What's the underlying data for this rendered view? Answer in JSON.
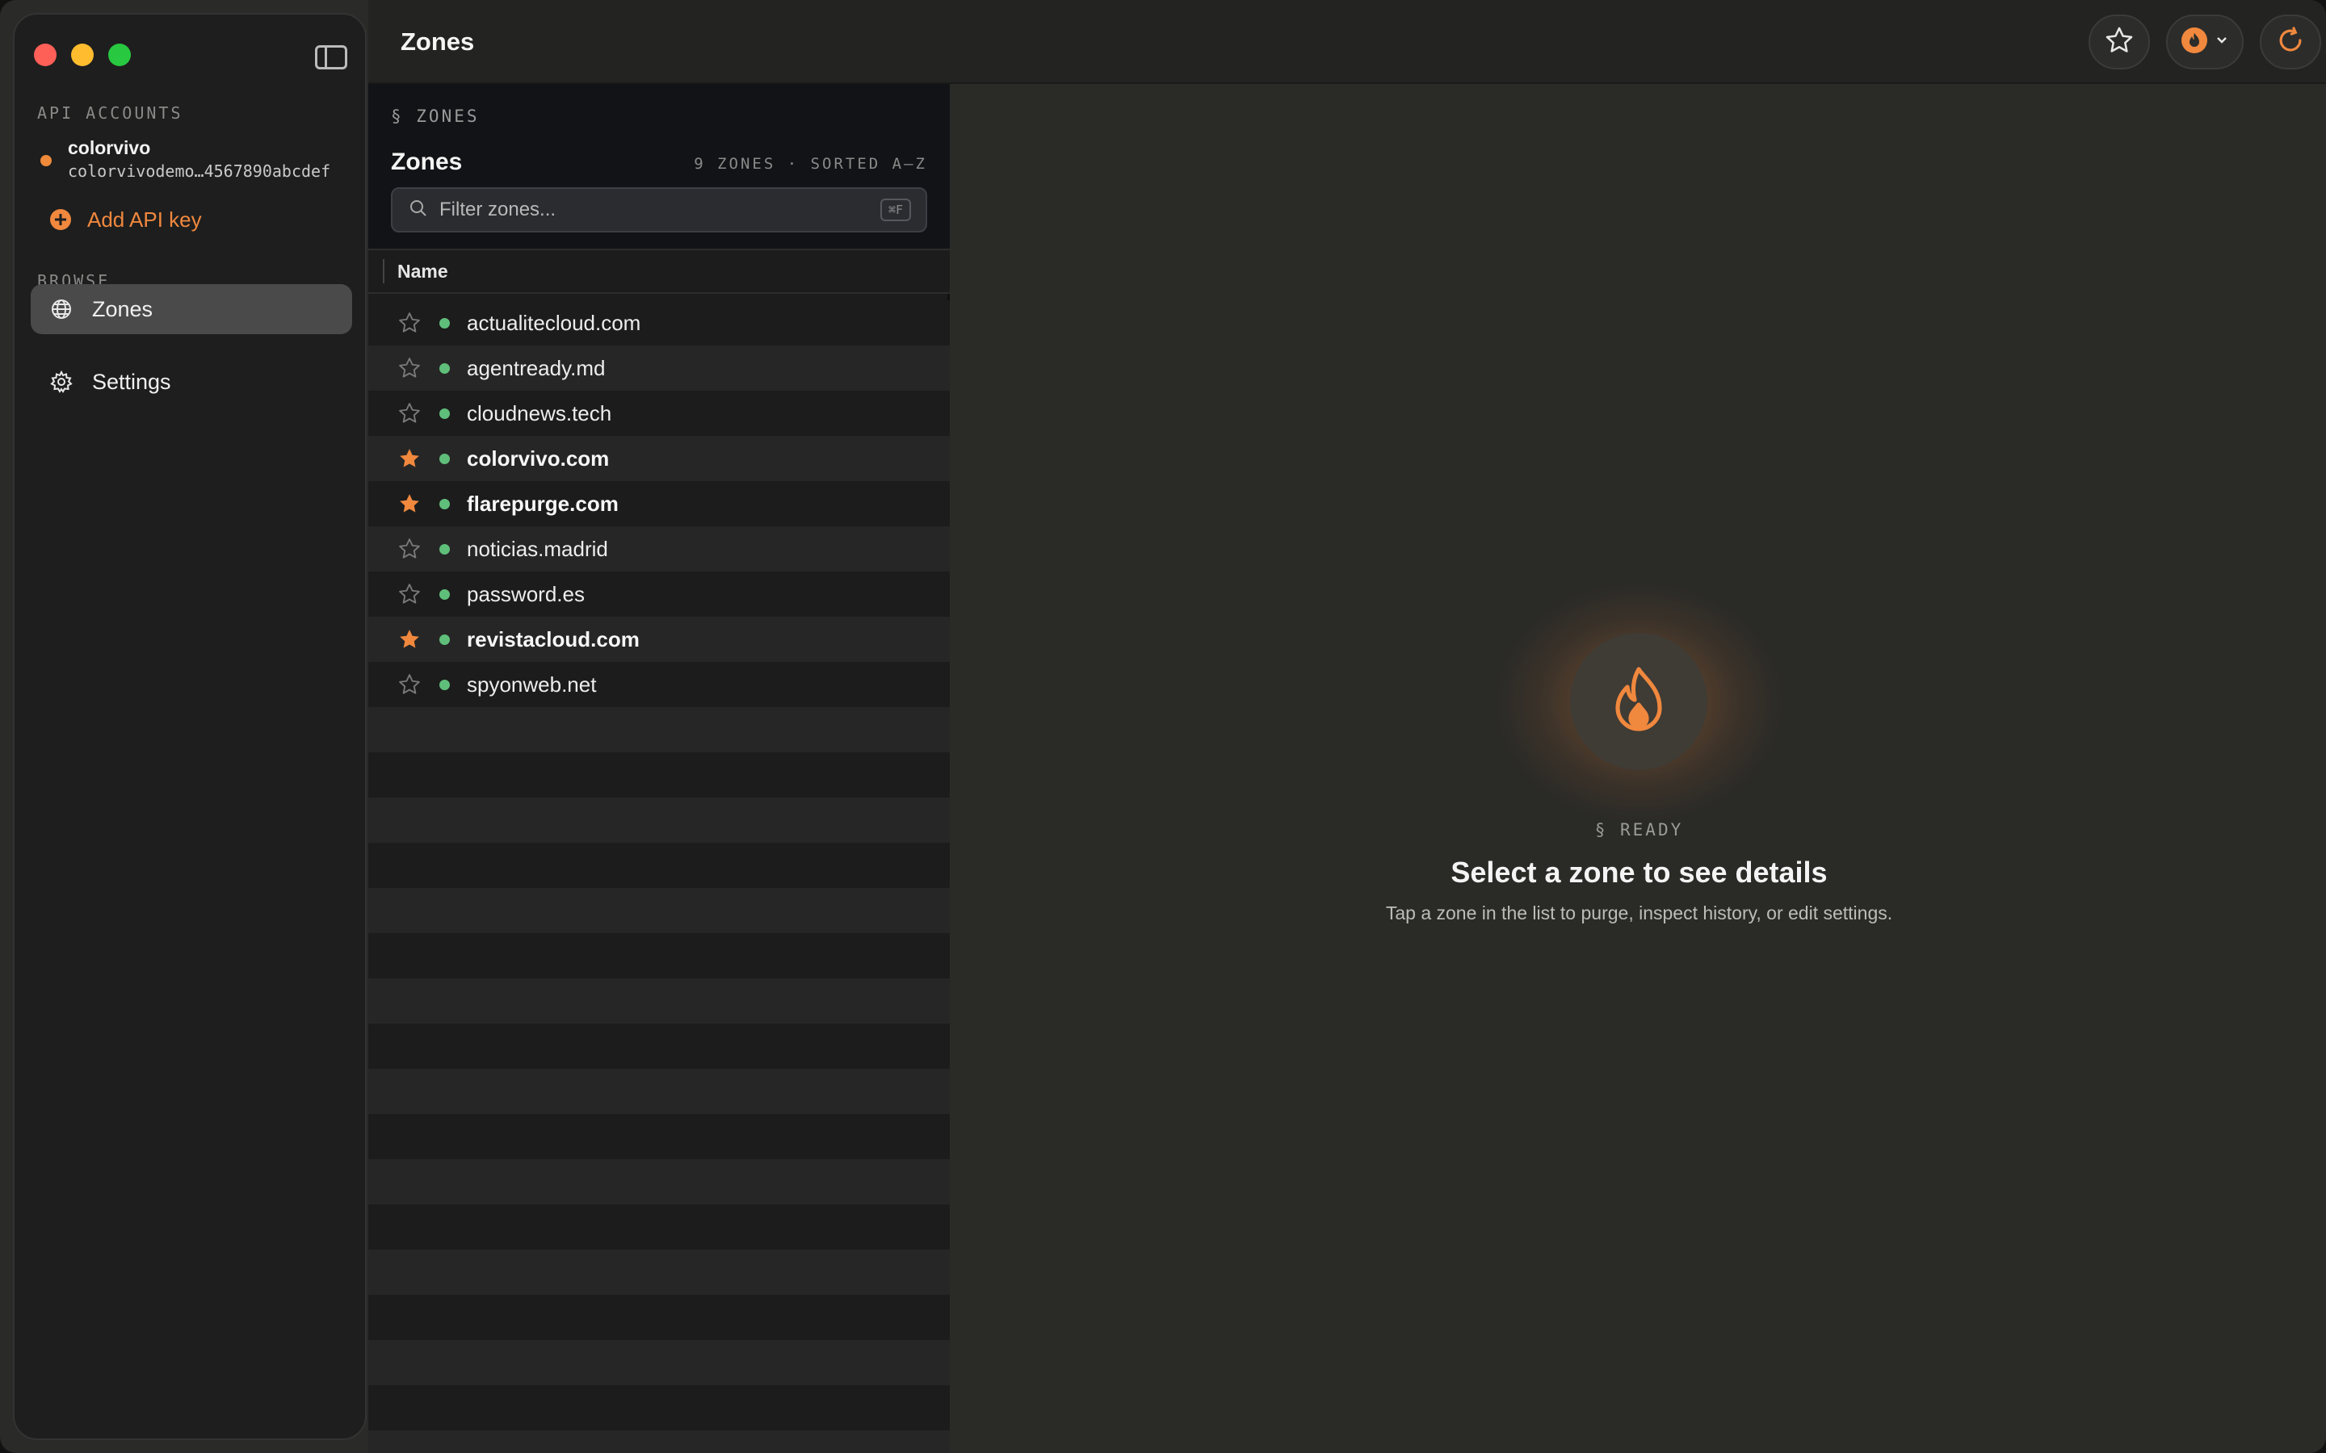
{
  "window": {
    "title": "Zones"
  },
  "sidebar": {
    "api_accounts_label": "API ACCOUNTS",
    "account": {
      "name": "colorvivo",
      "key": "colorvivodemo…4567890abcdef"
    },
    "add_key_label": "Add API key",
    "browse_label": "BROWSE",
    "items": [
      {
        "label": "Zones",
        "icon": "globe-icon",
        "active": true
      },
      {
        "label": "Settings",
        "icon": "gear-icon",
        "active": false
      }
    ]
  },
  "list": {
    "breadcrumb": "§ ZONES",
    "title": "Zones",
    "meta": "9 ZONES · SORTED A–Z",
    "filter_placeholder": "Filter zones...",
    "filter_shortcut": "⌘F",
    "column_name": "Name",
    "zones": [
      {
        "name": "actualitecloud.com",
        "favorite": false
      },
      {
        "name": "agentready.md",
        "favorite": false
      },
      {
        "name": "cloudnews.tech",
        "favorite": false
      },
      {
        "name": "colorvivo.com",
        "favorite": true
      },
      {
        "name": "flarepurge.com",
        "favorite": true
      },
      {
        "name": "noticias.madrid",
        "favorite": false
      },
      {
        "name": "password.es",
        "favorite": false
      },
      {
        "name": "revistacloud.com",
        "favorite": true
      },
      {
        "name": "spyonweb.net",
        "favorite": false
      }
    ]
  },
  "detail": {
    "status": "§ READY",
    "headline": "Select a zone to see details",
    "subtitle": "Tap a zone in the list to purge, inspect history, or edit settings."
  },
  "colors": {
    "accent": "#f0883e",
    "status_ok": "#5fbf7a"
  }
}
